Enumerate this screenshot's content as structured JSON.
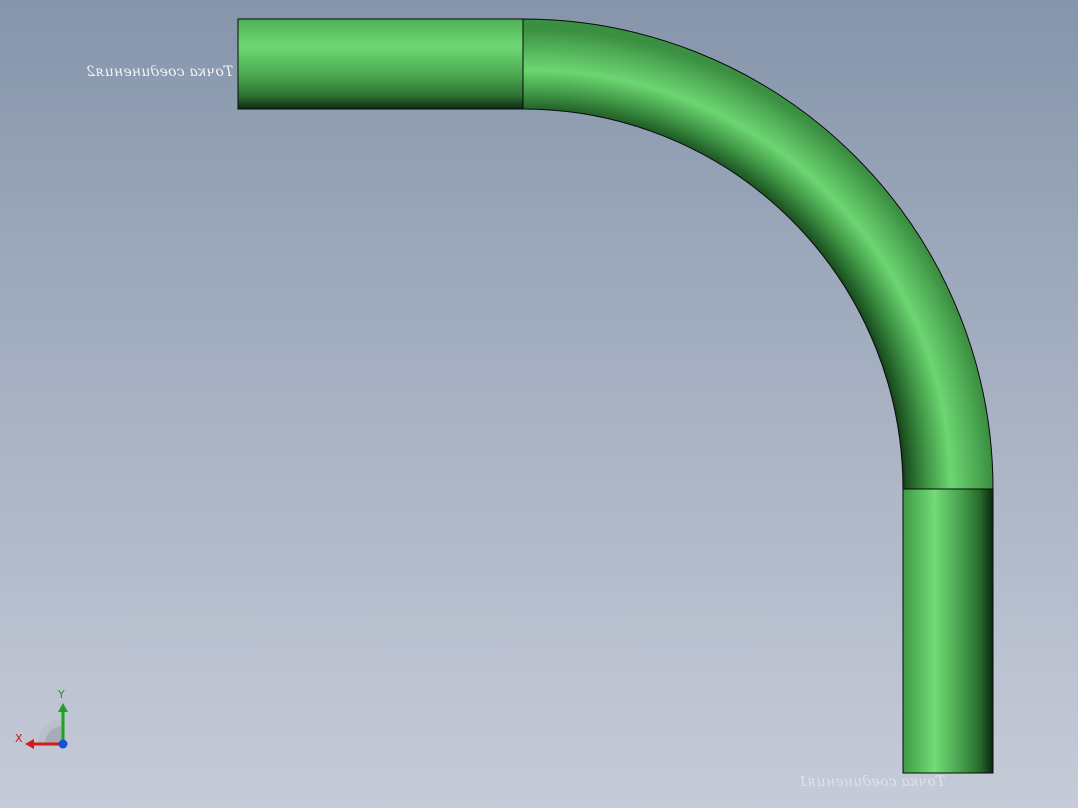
{
  "viewport": {
    "background_top": "#8695ab",
    "background_bottom": "#c6cbd8"
  },
  "model": {
    "part": "pipe-bend",
    "pipe_color": "#66cd6a",
    "pipe_shadow": "#0b2a0e",
    "edge_color": "#0a0a0a",
    "segments": [
      "straight-horizontal",
      "bend-90",
      "straight-vertical"
    ]
  },
  "labels": {
    "connection_point_top": "Точка соединения2",
    "connection_point_bottom": "Точка соединения1"
  },
  "triad": {
    "x_label": "X",
    "y_label": "Y",
    "x_color": "#d21a1a",
    "y_color": "#1aa51a",
    "z_color": "#1a4fd8"
  }
}
